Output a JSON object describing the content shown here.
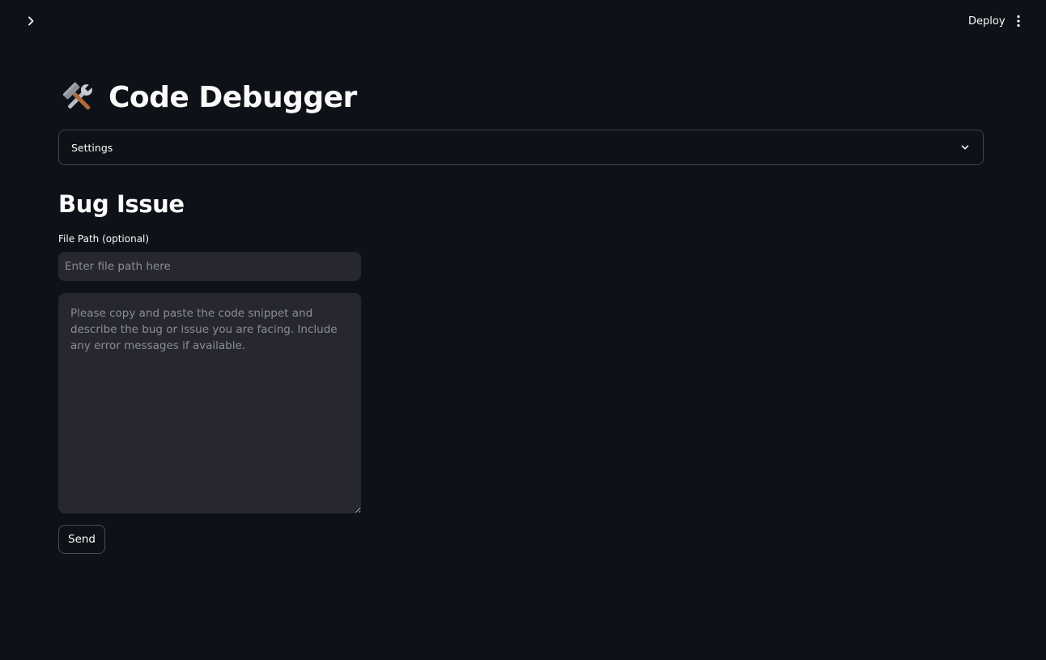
{
  "header": {
    "deploy_label": "Deploy"
  },
  "main": {
    "title": "Code Debugger",
    "title_icon": "hammer-and-wrench-icon",
    "settings": {
      "label": "Settings",
      "expanded": false
    },
    "section_heading": "Bug Issue",
    "file_path": {
      "label": "File Path (optional)",
      "value": "",
      "placeholder": "Enter file path here"
    },
    "bug_description": {
      "value": "",
      "placeholder": "Please copy and paste the code snippet and describe the bug or issue you are facing. Include any error messages if available."
    },
    "send_label": "Send"
  },
  "colors": {
    "background": "#0e1117",
    "input_background": "#262730",
    "text": "#fafafa",
    "placeholder": "#8c8d94",
    "border": "#3d3f46"
  }
}
